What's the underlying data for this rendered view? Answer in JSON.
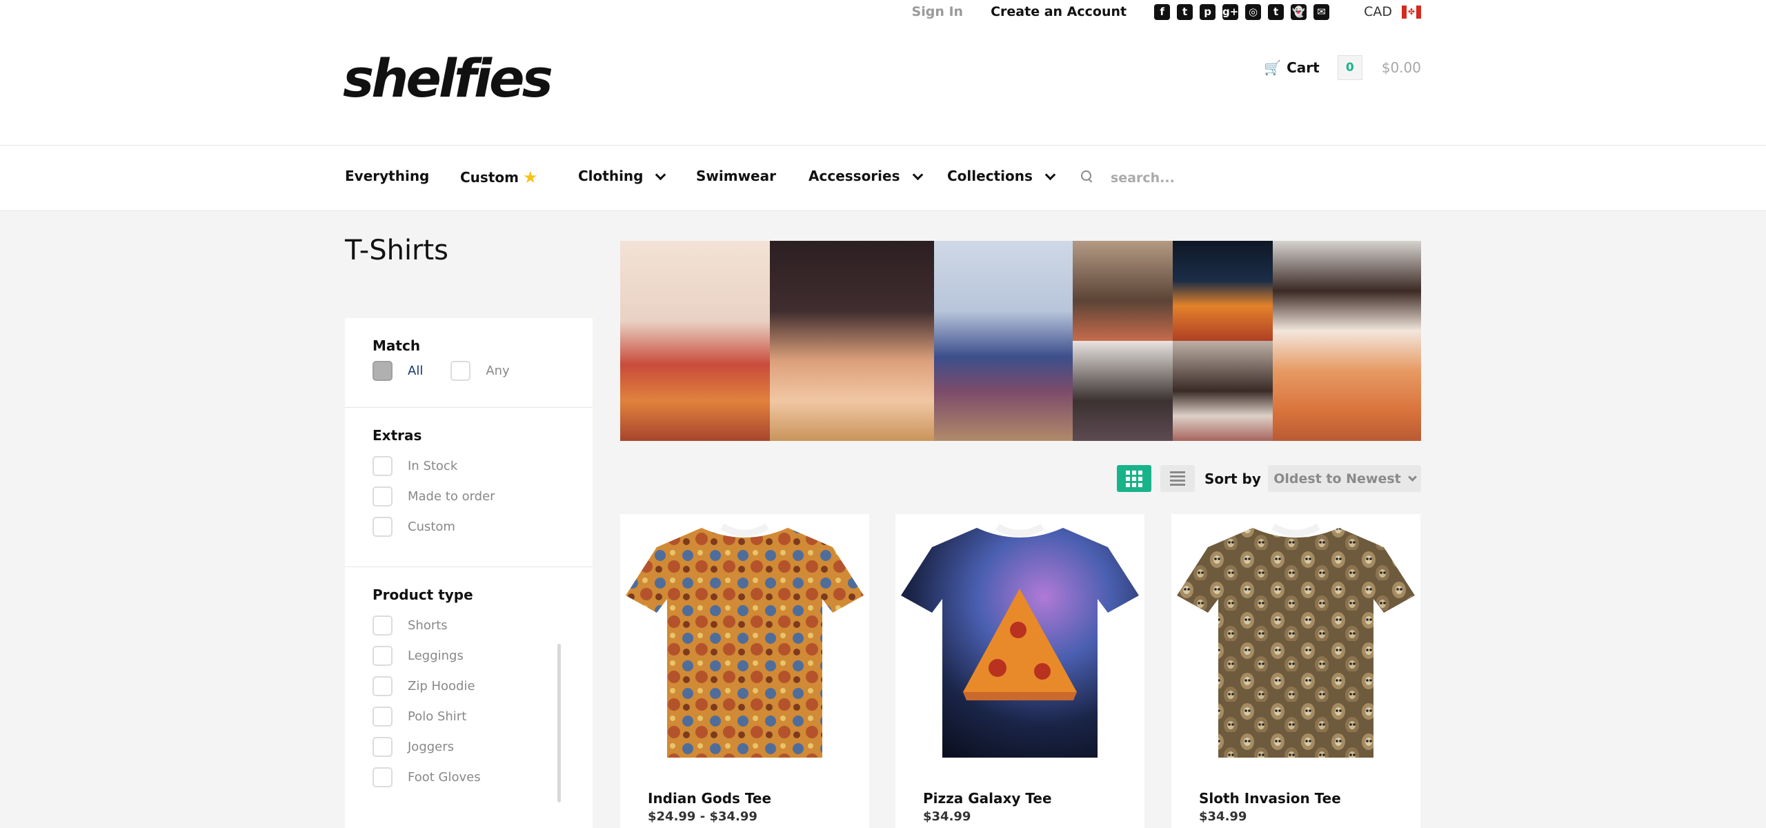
{
  "topbar": {
    "sign_in": "Sign In",
    "create_account": "Create an Account",
    "social_icons": [
      "facebook-icon",
      "twitter-icon",
      "pinterest-icon",
      "google-plus-icon",
      "instagram-icon",
      "tumblr-icon",
      "snapchat-icon",
      "email-icon"
    ],
    "social_glyphs": [
      "f",
      "t",
      "p",
      "g+",
      "◎",
      "t",
      "👻",
      "✉"
    ],
    "currency": "CAD"
  },
  "logo": "shelfies",
  "cart": {
    "label": "Cart",
    "count": "0",
    "total": "$0.00"
  },
  "nav": {
    "items": [
      {
        "label": "Everything"
      },
      {
        "label": "Custom"
      },
      {
        "label": "Clothing"
      },
      {
        "label": "Swimwear"
      },
      {
        "label": "Accessories"
      },
      {
        "label": "Collections"
      }
    ],
    "search_placeholder": "search..."
  },
  "page": {
    "title": "T-Shirts"
  },
  "filters": {
    "match": {
      "title": "Match",
      "options": [
        "All",
        "Any"
      ],
      "selected": "All"
    },
    "extras": {
      "title": "Extras",
      "options": [
        "In Stock",
        "Made to order",
        "Custom"
      ]
    },
    "product_type": {
      "title": "Product type",
      "options": [
        "Shorts",
        "Leggings",
        "Zip Hoodie",
        "Polo Shirt",
        "Joggers",
        "Foot Gloves"
      ]
    }
  },
  "sort": {
    "label": "Sort by",
    "value": "Oldest to Newest"
  },
  "colors": {
    "accent": "#19b38a",
    "nav_text": "#111111",
    "muted": "#9a9a9a"
  },
  "products": [
    {
      "name": "Indian Gods Tee",
      "price": "$24.99 - $34.99"
    },
    {
      "name": "Pizza Galaxy Tee",
      "price": "$34.99"
    },
    {
      "name": "Sloth Invasion Tee",
      "price": "$34.99"
    }
  ]
}
